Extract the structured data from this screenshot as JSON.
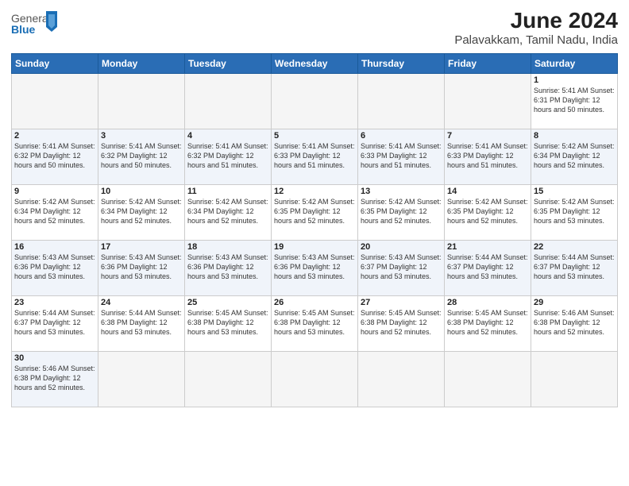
{
  "header": {
    "logo_general": "General",
    "logo_blue": "Blue",
    "title": "June 2024",
    "subtitle": "Palavakkam, Tamil Nadu, India"
  },
  "weekdays": [
    "Sunday",
    "Monday",
    "Tuesday",
    "Wednesday",
    "Thursday",
    "Friday",
    "Saturday"
  ],
  "weeks": [
    [
      {
        "day": "",
        "info": ""
      },
      {
        "day": "",
        "info": ""
      },
      {
        "day": "",
        "info": ""
      },
      {
        "day": "",
        "info": ""
      },
      {
        "day": "",
        "info": ""
      },
      {
        "day": "",
        "info": ""
      },
      {
        "day": "1",
        "info": "Sunrise: 5:41 AM\nSunset: 6:31 PM\nDaylight: 12 hours\nand 50 minutes."
      }
    ],
    [
      {
        "day": "2",
        "info": "Sunrise: 5:41 AM\nSunset: 6:32 PM\nDaylight: 12 hours\nand 50 minutes."
      },
      {
        "day": "3",
        "info": "Sunrise: 5:41 AM\nSunset: 6:32 PM\nDaylight: 12 hours\nand 50 minutes."
      },
      {
        "day": "4",
        "info": "Sunrise: 5:41 AM\nSunset: 6:32 PM\nDaylight: 12 hours\nand 51 minutes."
      },
      {
        "day": "5",
        "info": "Sunrise: 5:41 AM\nSunset: 6:33 PM\nDaylight: 12 hours\nand 51 minutes."
      },
      {
        "day": "6",
        "info": "Sunrise: 5:41 AM\nSunset: 6:33 PM\nDaylight: 12 hours\nand 51 minutes."
      },
      {
        "day": "7",
        "info": "Sunrise: 5:41 AM\nSunset: 6:33 PM\nDaylight: 12 hours\nand 51 minutes."
      },
      {
        "day": "8",
        "info": "Sunrise: 5:42 AM\nSunset: 6:34 PM\nDaylight: 12 hours\nand 52 minutes."
      }
    ],
    [
      {
        "day": "9",
        "info": "Sunrise: 5:42 AM\nSunset: 6:34 PM\nDaylight: 12 hours\nand 52 minutes."
      },
      {
        "day": "10",
        "info": "Sunrise: 5:42 AM\nSunset: 6:34 PM\nDaylight: 12 hours\nand 52 minutes."
      },
      {
        "day": "11",
        "info": "Sunrise: 5:42 AM\nSunset: 6:34 PM\nDaylight: 12 hours\nand 52 minutes."
      },
      {
        "day": "12",
        "info": "Sunrise: 5:42 AM\nSunset: 6:35 PM\nDaylight: 12 hours\nand 52 minutes."
      },
      {
        "day": "13",
        "info": "Sunrise: 5:42 AM\nSunset: 6:35 PM\nDaylight: 12 hours\nand 52 minutes."
      },
      {
        "day": "14",
        "info": "Sunrise: 5:42 AM\nSunset: 6:35 PM\nDaylight: 12 hours\nand 52 minutes."
      },
      {
        "day": "15",
        "info": "Sunrise: 5:42 AM\nSunset: 6:35 PM\nDaylight: 12 hours\nand 53 minutes."
      }
    ],
    [
      {
        "day": "16",
        "info": "Sunrise: 5:43 AM\nSunset: 6:36 PM\nDaylight: 12 hours\nand 53 minutes."
      },
      {
        "day": "17",
        "info": "Sunrise: 5:43 AM\nSunset: 6:36 PM\nDaylight: 12 hours\nand 53 minutes."
      },
      {
        "day": "18",
        "info": "Sunrise: 5:43 AM\nSunset: 6:36 PM\nDaylight: 12 hours\nand 53 minutes."
      },
      {
        "day": "19",
        "info": "Sunrise: 5:43 AM\nSunset: 6:36 PM\nDaylight: 12 hours\nand 53 minutes."
      },
      {
        "day": "20",
        "info": "Sunrise: 5:43 AM\nSunset: 6:37 PM\nDaylight: 12 hours\nand 53 minutes."
      },
      {
        "day": "21",
        "info": "Sunrise: 5:44 AM\nSunset: 6:37 PM\nDaylight: 12 hours\nand 53 minutes."
      },
      {
        "day": "22",
        "info": "Sunrise: 5:44 AM\nSunset: 6:37 PM\nDaylight: 12 hours\nand 53 minutes."
      }
    ],
    [
      {
        "day": "23",
        "info": "Sunrise: 5:44 AM\nSunset: 6:37 PM\nDaylight: 12 hours\nand 53 minutes."
      },
      {
        "day": "24",
        "info": "Sunrise: 5:44 AM\nSunset: 6:38 PM\nDaylight: 12 hours\nand 53 minutes."
      },
      {
        "day": "25",
        "info": "Sunrise: 5:45 AM\nSunset: 6:38 PM\nDaylight: 12 hours\nand 53 minutes."
      },
      {
        "day": "26",
        "info": "Sunrise: 5:45 AM\nSunset: 6:38 PM\nDaylight: 12 hours\nand 53 minutes."
      },
      {
        "day": "27",
        "info": "Sunrise: 5:45 AM\nSunset: 6:38 PM\nDaylight: 12 hours\nand 52 minutes."
      },
      {
        "day": "28",
        "info": "Sunrise: 5:45 AM\nSunset: 6:38 PM\nDaylight: 12 hours\nand 52 minutes."
      },
      {
        "day": "29",
        "info": "Sunrise: 5:46 AM\nSunset: 6:38 PM\nDaylight: 12 hours\nand 52 minutes."
      }
    ],
    [
      {
        "day": "30",
        "info": "Sunrise: 5:46 AM\nSunset: 6:38 PM\nDaylight: 12 hours\nand 52 minutes."
      },
      {
        "day": "",
        "info": ""
      },
      {
        "day": "",
        "info": ""
      },
      {
        "day": "",
        "info": ""
      },
      {
        "day": "",
        "info": ""
      },
      {
        "day": "",
        "info": ""
      },
      {
        "day": "",
        "info": ""
      }
    ]
  ]
}
